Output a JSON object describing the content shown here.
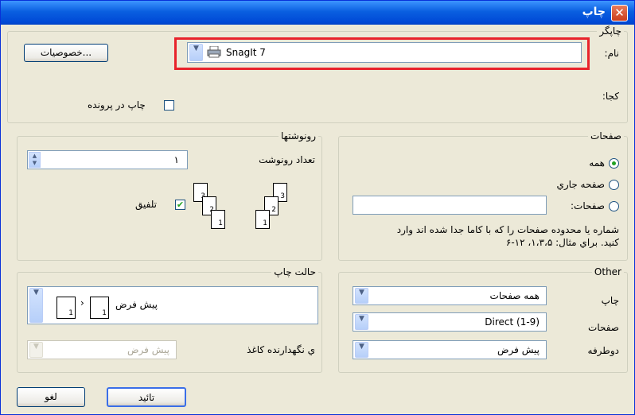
{
  "title": "چاپ",
  "printer": {
    "legend": "چاپگر",
    "name_label": "نام:",
    "where_label": "کجا:",
    "selected": "SnagIt 7",
    "properties_button": "خصوصیات...",
    "print_to_file_label": "چاپ در پرونده",
    "print_to_file_checked": false
  },
  "pages": {
    "legend": "صفحات",
    "options": [
      {
        "label": "همه",
        "selected": true
      },
      {
        "label": "صفحه جاري",
        "selected": false
      },
      {
        "label": "صفحات:",
        "selected": false
      }
    ],
    "pages_input_value": "",
    "hint_line1": "شماره يا محدوده صفحات را كه با كاما جدا شده اند وارد",
    "hint_line2": "كنيد. براي مثال: ۱،۳،۵، ۱۲-۶"
  },
  "copies": {
    "legend": "رونوشتها",
    "count_label": "تعداد رونوشت",
    "count_value": "۱",
    "collate_label": "تلفيق",
    "collate_checked": true,
    "collate_pages": [
      "1",
      "2",
      "3"
    ]
  },
  "print_mode": {
    "legend": "حالت چاپ",
    "selected": "پيش فرض",
    "page_numbers": [
      "1",
      "1"
    ],
    "paper_holder_label": "ي نگهدارنده كاغذ",
    "paper_holder_value": "پيش فرض"
  },
  "other": {
    "legend": "Other",
    "print_label": "چاپ",
    "print_value": "همه صفحات",
    "pages_label": "صفحات",
    "pages_value": "(Direct (1-9",
    "duplex_label": "دوطرفه",
    "duplex_value": "پيش فرض"
  },
  "buttons": {
    "ok": "تائيد",
    "cancel": "لغو"
  },
  "colors": {
    "title_bar": "#0a5fe0",
    "highlight_border": "#e8232b",
    "dialog_bg": "#ece9d8"
  }
}
